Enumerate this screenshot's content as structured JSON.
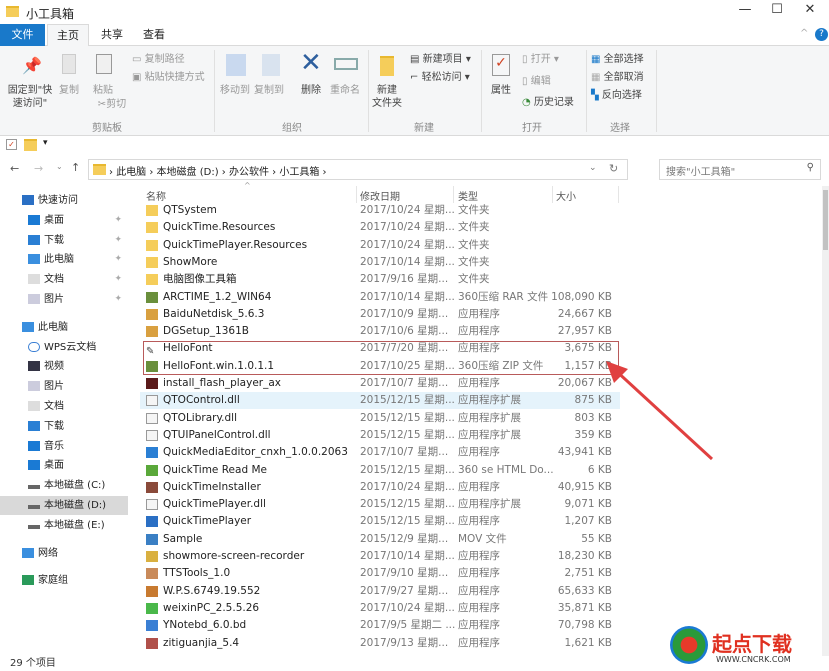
{
  "window": {
    "title": "小工具箱",
    "minimize": "—",
    "maximize": "☐",
    "close": "✕"
  },
  "tabs": [
    "文件",
    "主页",
    "共享",
    "查看"
  ],
  "ribbon": {
    "pin": "固定到\"快\n速访问\"",
    "copy": "复制",
    "paste": "粘贴",
    "copy_path": "复制路径",
    "paste_shortcut": "粘贴快捷方式",
    "cut": "剪切",
    "clipboard_group": "剪贴板",
    "move_to": "移动到",
    "copy_to": "复制到",
    "delete": "删除",
    "rename": "重命名",
    "organize_group": "组织",
    "new_folder": "新建\n文件夹",
    "new_item": "新建项目 ▾",
    "easy_access": "轻松访问 ▾",
    "new_group": "新建",
    "properties": "属性",
    "open": "打开 ▾",
    "edit": "编辑",
    "history": "历史记录",
    "open_group": "打开",
    "select_all": "全部选择",
    "select_none": "全部取消",
    "invert": "反向选择",
    "select_group": "选择"
  },
  "address": {
    "crumbs": [
      "此电脑",
      "本地磁盘 (D:)",
      "办公软件",
      "小工具箱"
    ],
    "search_placeholder": "搜索\"小工具箱\""
  },
  "sidebar": [
    {
      "label": "快速访问",
      "icon": "star-icon",
      "level": 0
    },
    {
      "label": "桌面",
      "icon": "desktop-icon",
      "level": 1,
      "pin": true
    },
    {
      "label": "下载",
      "icon": "download-icon",
      "level": 1,
      "pin": true
    },
    {
      "label": "此电脑",
      "icon": "computer-icon",
      "level": 1,
      "pin": true
    },
    {
      "label": "文档",
      "icon": "document-icon",
      "level": 1,
      "pin": true
    },
    {
      "label": "图片",
      "icon": "picture-icon",
      "level": 1,
      "pin": true
    },
    {
      "label": "此电脑",
      "icon": "computer-icon",
      "level": 0
    },
    {
      "label": "WPS云文档",
      "icon": "cloud-icon",
      "level": 1
    },
    {
      "label": "视频",
      "icon": "video-icon",
      "level": 1
    },
    {
      "label": "图片",
      "icon": "picture-icon",
      "level": 1
    },
    {
      "label": "文档",
      "icon": "document-icon",
      "level": 1
    },
    {
      "label": "下载",
      "icon": "download-icon",
      "level": 1
    },
    {
      "label": "音乐",
      "icon": "music-icon",
      "level": 1
    },
    {
      "label": "桌面",
      "icon": "desktop-icon",
      "level": 1
    },
    {
      "label": "本地磁盘 (C:)",
      "icon": "drive-icon",
      "level": 1
    },
    {
      "label": "本地磁盘 (D:)",
      "icon": "drive-icon",
      "level": 1,
      "selected": true
    },
    {
      "label": "本地磁盘 (E:)",
      "icon": "drive-icon",
      "level": 1
    },
    {
      "label": "网络",
      "icon": "network-icon",
      "level": 0
    },
    {
      "label": "家庭组",
      "icon": "homegroup-icon",
      "level": 0
    }
  ],
  "columns": {
    "name": "名称",
    "date": "修改日期",
    "type": "类型",
    "size": "大小"
  },
  "files": [
    {
      "name": "QTSystem",
      "date": "2017/10/24 星期...",
      "type": "文件夹",
      "size": "",
      "icon": "folder",
      "color": "#f5cd5a"
    },
    {
      "name": "QuickTime.Resources",
      "date": "2017/10/24 星期...",
      "type": "文件夹",
      "size": "",
      "icon": "folder",
      "color": "#f5cd5a"
    },
    {
      "name": "QuickTimePlayer.Resources",
      "date": "2017/10/24 星期...",
      "type": "文件夹",
      "size": "",
      "icon": "folder",
      "color": "#f5cd5a"
    },
    {
      "name": "ShowMore",
      "date": "2017/10/14 星期...",
      "type": "文件夹",
      "size": "",
      "icon": "folder",
      "color": "#f5cd5a"
    },
    {
      "name": "电脑图像工具箱",
      "date": "2017/9/16 星期...",
      "type": "文件夹",
      "size": "",
      "icon": "folder",
      "color": "#f5cd5a"
    },
    {
      "name": "ARCTIME_1.2_WIN64",
      "date": "2017/10/14 星期...",
      "type": "360压缩 RAR 文件",
      "size": "108,090 KB",
      "icon": "archive",
      "color": "#6a8f3c"
    },
    {
      "name": "BaiduNetdisk_5.6.3",
      "date": "2017/10/9 星期...",
      "type": "应用程序",
      "size": "24,667 KB",
      "icon": "app",
      "color": "#d9a040"
    },
    {
      "name": "DGSetup_1361B",
      "date": "2017/10/6 星期...",
      "type": "应用程序",
      "size": "27,957 KB",
      "icon": "app",
      "color": "#d9a040"
    },
    {
      "name": "HelloFont",
      "date": "2017/7/20 星期...",
      "type": "应用程序",
      "size": "3,675 KB",
      "icon": "pen",
      "color": "#555555"
    },
    {
      "name": "HelloFont.win.1.0.1.1",
      "date": "2017/10/25 星期...",
      "type": "360压缩 ZIP 文件",
      "size": "1,157 KB",
      "icon": "archive",
      "color": "#6a8f3c"
    },
    {
      "name": "install_flash_player_ax",
      "date": "2017/10/7 星期...",
      "type": "应用程序",
      "size": "20,067 KB",
      "icon": "app",
      "color": "#5a1a1a"
    },
    {
      "name": "QTOControl.dll",
      "date": "2015/12/15 星期...",
      "type": "应用程序扩展",
      "size": "875 KB",
      "icon": "dll",
      "color": "#dddddd",
      "selected": true
    },
    {
      "name": "QTOLibrary.dll",
      "date": "2015/12/15 星期...",
      "type": "应用程序扩展",
      "size": "803 KB",
      "icon": "dll",
      "color": "#dddddd"
    },
    {
      "name": "QTUIPanelControl.dll",
      "date": "2015/12/15 星期...",
      "type": "应用程序扩展",
      "size": "359 KB",
      "icon": "dll",
      "color": "#dddddd"
    },
    {
      "name": "QuickMediaEditor_cnxh_1.0.0.2063",
      "date": "2017/10/7 星期...",
      "type": "应用程序",
      "size": "43,941 KB",
      "icon": "app",
      "color": "#2a7fd4"
    },
    {
      "name": "QuickTime Read Me",
      "date": "2015/12/15 星期...",
      "type": "360 se HTML Do...",
      "size": "6 KB",
      "icon": "html",
      "color": "#5aa83a"
    },
    {
      "name": "QuickTimeInstaller",
      "date": "2017/10/24 星期...",
      "type": "应用程序",
      "size": "40,915 KB",
      "icon": "app",
      "color": "#8a4a3a"
    },
    {
      "name": "QuickTimePlayer.dll",
      "date": "2015/12/15 星期...",
      "type": "应用程序扩展",
      "size": "9,071 KB",
      "icon": "dll",
      "color": "#dddddd"
    },
    {
      "name": "QuickTimePlayer",
      "date": "2015/12/15 星期...",
      "type": "应用程序",
      "size": "1,207 KB",
      "icon": "app",
      "color": "#2a6fc4"
    },
    {
      "name": "Sample",
      "date": "2015/12/9 星期...",
      "type": "MOV 文件",
      "size": "55 KB",
      "icon": "video",
      "color": "#3a7fc4"
    },
    {
      "name": "showmore-screen-recorder",
      "date": "2017/10/14 星期...",
      "type": "应用程序",
      "size": "18,230 KB",
      "icon": "app",
      "color": "#d9b040"
    },
    {
      "name": "TTSTools_1.0",
      "date": "2017/9/10 星期...",
      "type": "应用程序",
      "size": "2,751 KB",
      "icon": "app",
      "color": "#c98a5a"
    },
    {
      "name": "W.P.S.6749.19.552",
      "date": "2017/9/27 星期...",
      "type": "应用程序",
      "size": "65,633 KB",
      "icon": "app",
      "color": "#c87a30"
    },
    {
      "name": "weixinPC_2.5.5.26",
      "date": "2017/10/24 星期...",
      "type": "应用程序",
      "size": "35,871 KB",
      "icon": "app",
      "color": "#4ab84a"
    },
    {
      "name": "YNotebd_6.0.bd",
      "date": "2017/9/5 星期二 ...",
      "type": "应用程序",
      "size": "70,798 KB",
      "icon": "app",
      "color": "#3a7fd4"
    },
    {
      "name": "zitiguanjia_5.4",
      "date": "2017/9/13 星期...",
      "type": "应用程序",
      "size": "1,621 KB",
      "icon": "app",
      "color": "#b0504a"
    }
  ],
  "status": {
    "count": "29 个项目"
  },
  "logo": {
    "text": "起点下载",
    "url_text": "WWW.CNCRK.COM"
  },
  "colors": {
    "accent": "#1979ca",
    "annotation": "#e04040"
  }
}
